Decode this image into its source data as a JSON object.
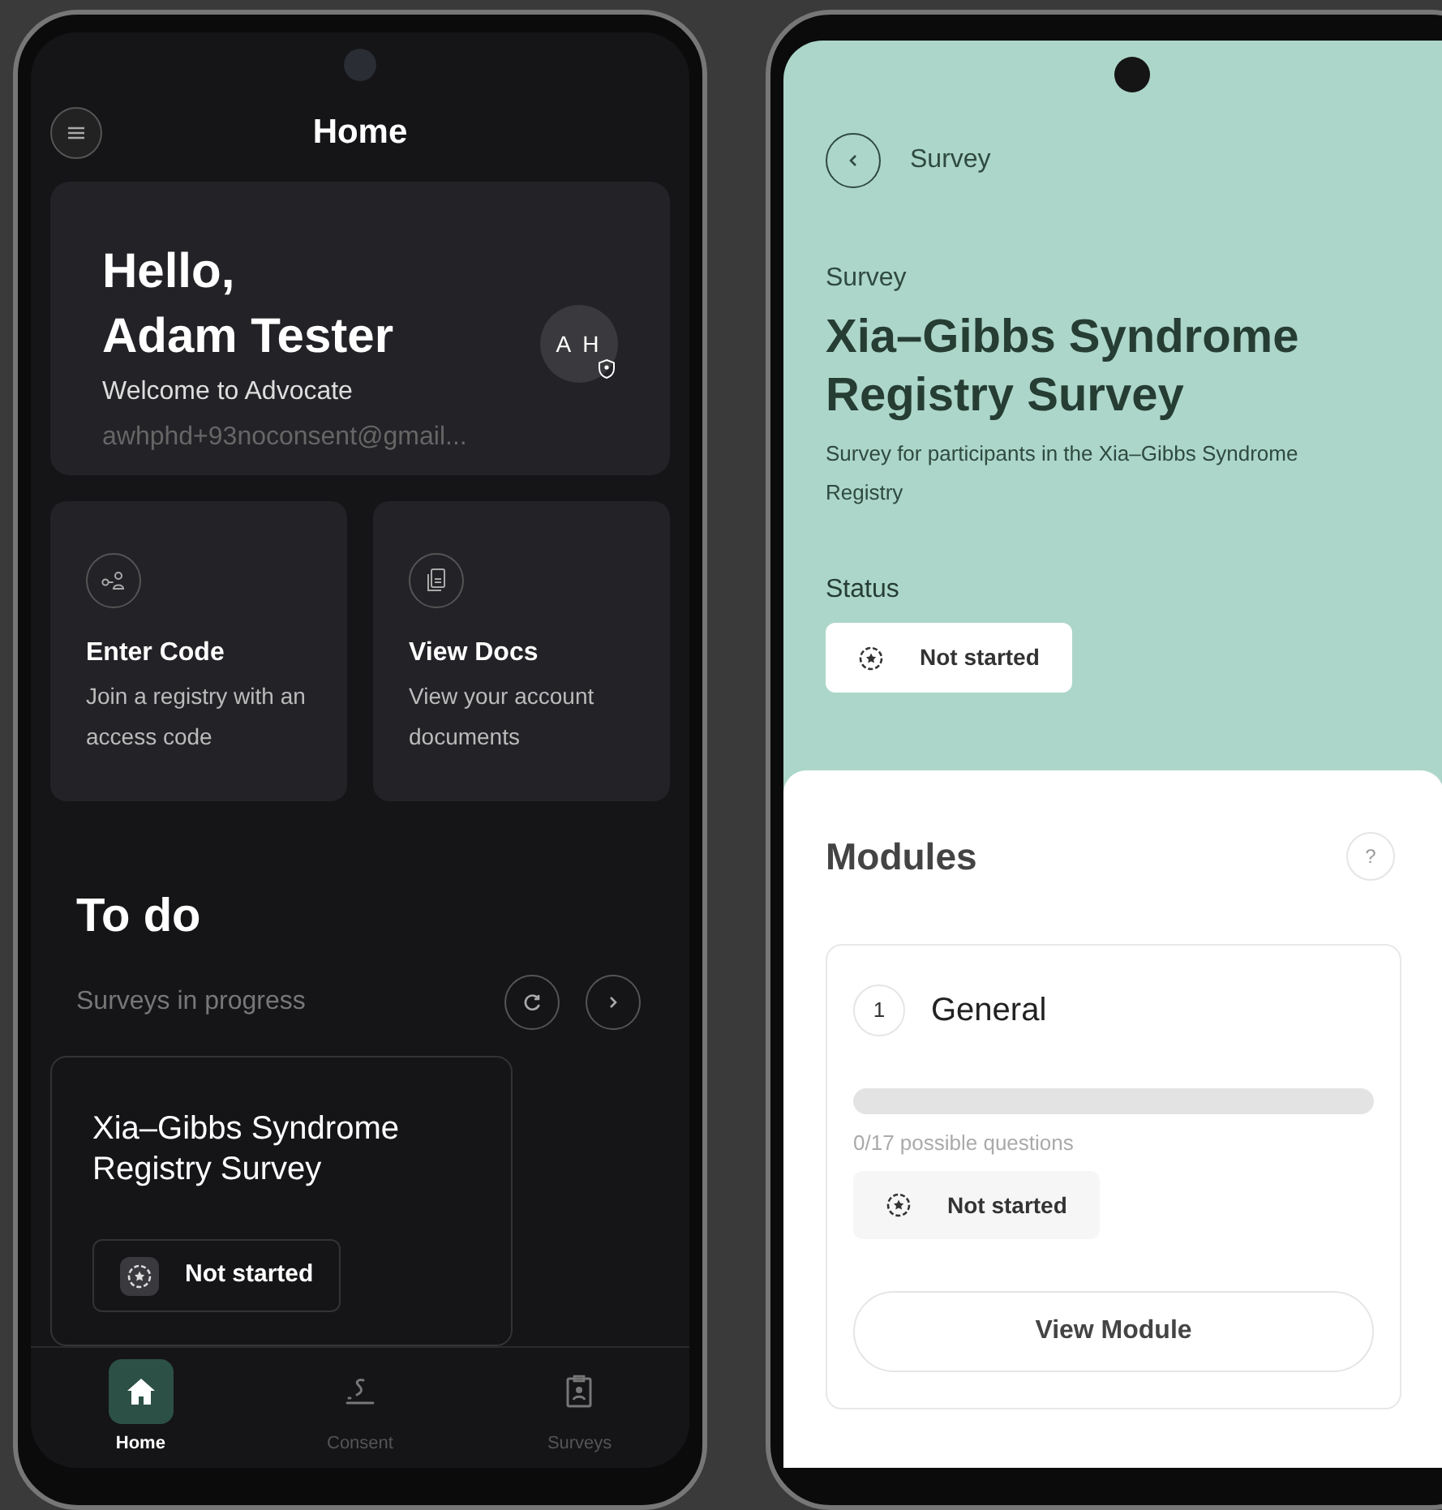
{
  "home_screen": {
    "title": "Home",
    "greeting": "Hello,",
    "user_name": "Adam Tester",
    "welcome": "Welcome to Advocate",
    "email": "awhphd+93noconsent@gmail...",
    "avatar_initials": "A H",
    "action_cards": [
      {
        "title": "Enter Code",
        "description": "Join a registry with an access code"
      },
      {
        "title": "View Docs",
        "description": "View your account documents"
      }
    ],
    "todo": {
      "title": "To do",
      "subtitle": "Surveys in progress",
      "survey_card": {
        "title": "Xia–Gibbs Syndrome Registry Survey",
        "status": "Not started"
      }
    },
    "bottom_nav": [
      {
        "label": "Home",
        "selected": true
      },
      {
        "label": "Consent",
        "selected": false
      },
      {
        "label": "Surveys",
        "selected": false
      }
    ]
  },
  "survey_screen": {
    "back_label": "Survey",
    "eyebrow": "Survey",
    "title": "Xia–Gibbs Syndrome Registry Survey",
    "description": "Survey for participants in the Xia–Gibbs Syndrome Registry",
    "status_label": "Status",
    "status": "Not started",
    "modules_title": "Modules",
    "help": "?",
    "modules": [
      {
        "number": "1",
        "name": "General",
        "level": 0,
        "progress_text": "0/17 possible questions",
        "status": "Not started",
        "button": "View Module"
      }
    ]
  }
}
